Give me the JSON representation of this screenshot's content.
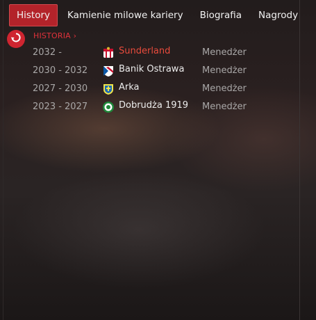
{
  "tabs": [
    {
      "label": "History",
      "active": true
    },
    {
      "label": "Kamienie milowe kariery",
      "active": false
    },
    {
      "label": "Biografia",
      "active": false
    },
    {
      "label": "Nagrody",
      "active": false
    }
  ],
  "breadcrumb": {
    "label": "HISTORIA ›"
  },
  "back_icon": "undo-arrow-icon",
  "history": [
    {
      "years": "2032 -",
      "club": "Sunderland",
      "role": "Menedżer",
      "highlight": true,
      "badge": "sunderland-crest-icon"
    },
    {
      "years": "2030 - 2032",
      "club": "Banik Ostrawa",
      "role": "Menedżer",
      "highlight": false,
      "badge": "banik-crest-icon"
    },
    {
      "years": "2027 - 2030",
      "club": "Arka",
      "role": "Menedżer",
      "highlight": false,
      "badge": "arka-crest-icon"
    },
    {
      "years": "2023 - 2027",
      "club": "Dobrudża 1919",
      "role": "Menedżer",
      "highlight": false,
      "badge": "dobrudzha-crest-icon"
    }
  ],
  "colors": {
    "accent": "#b3232a",
    "highlight_text": "#e94b3c",
    "muted_text": "#a9a7a7"
  }
}
